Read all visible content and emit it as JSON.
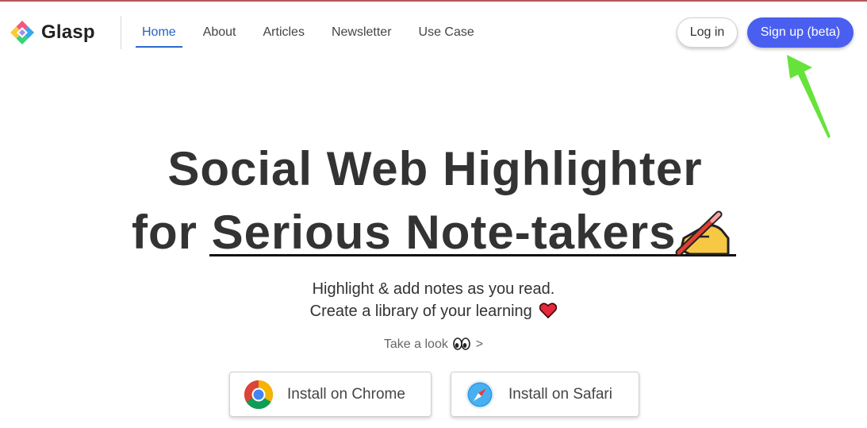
{
  "brand": {
    "name": "Glasp",
    "logo_icon": "glasp-diamond-logo"
  },
  "nav": {
    "items": [
      {
        "label": "Home",
        "active": true
      },
      {
        "label": "About",
        "active": false
      },
      {
        "label": "Articles",
        "active": false
      },
      {
        "label": "Newsletter",
        "active": false
      },
      {
        "label": "Use Case",
        "active": false
      }
    ],
    "active_color": "#2362c4"
  },
  "auth": {
    "login_label": "Log in",
    "signup_label": "Sign up (beta)",
    "signup_color": "#4a5fef"
  },
  "annotation": {
    "arrow_icon": "green-arrow-pointing-to-signup",
    "arrow_color": "#66e33a"
  },
  "hero": {
    "line1": "Social Web Highlighter",
    "line2_prefix": "for ",
    "line2_underlined": "Serious Note-takers",
    "line2_emoji": "writing-hand-icon",
    "sub1": "Highlight & add notes as you read.",
    "sub2": "Create a library of your learning",
    "sub2_emoji": "heart-icon",
    "take_look_label": "Take a look",
    "take_look_emoji": "eyes-icon",
    "take_look_chevron": ">"
  },
  "install": {
    "chrome_label": "Install on Chrome",
    "chrome_icon": "chrome-icon",
    "safari_label": "Install on Safari",
    "safari_icon": "safari-icon"
  }
}
